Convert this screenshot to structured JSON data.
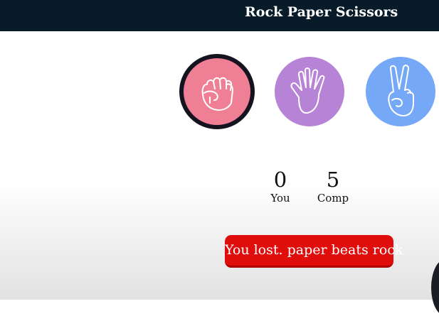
{
  "header": {
    "title": "Rock Paper Scissors"
  },
  "choices": [
    {
      "name": "rock",
      "icon": "fist-icon",
      "color": "#ef7f95",
      "selected": true
    },
    {
      "name": "paper",
      "icon": "open-hand-icon",
      "color": "#b783d7",
      "selected": false
    },
    {
      "name": "scissors",
      "icon": "peace-hand-icon",
      "color": "#75a8f6",
      "selected": false
    }
  ],
  "scoreboard": {
    "user": {
      "score": "0",
      "label": "You"
    },
    "comp": {
      "score": "5",
      "label": "Comp"
    }
  },
  "result": {
    "message": "You lost. paper beats rock",
    "color": "#e00d0d"
  },
  "colors": {
    "navbar": "#081b29",
    "selected_border": "#14131f"
  }
}
